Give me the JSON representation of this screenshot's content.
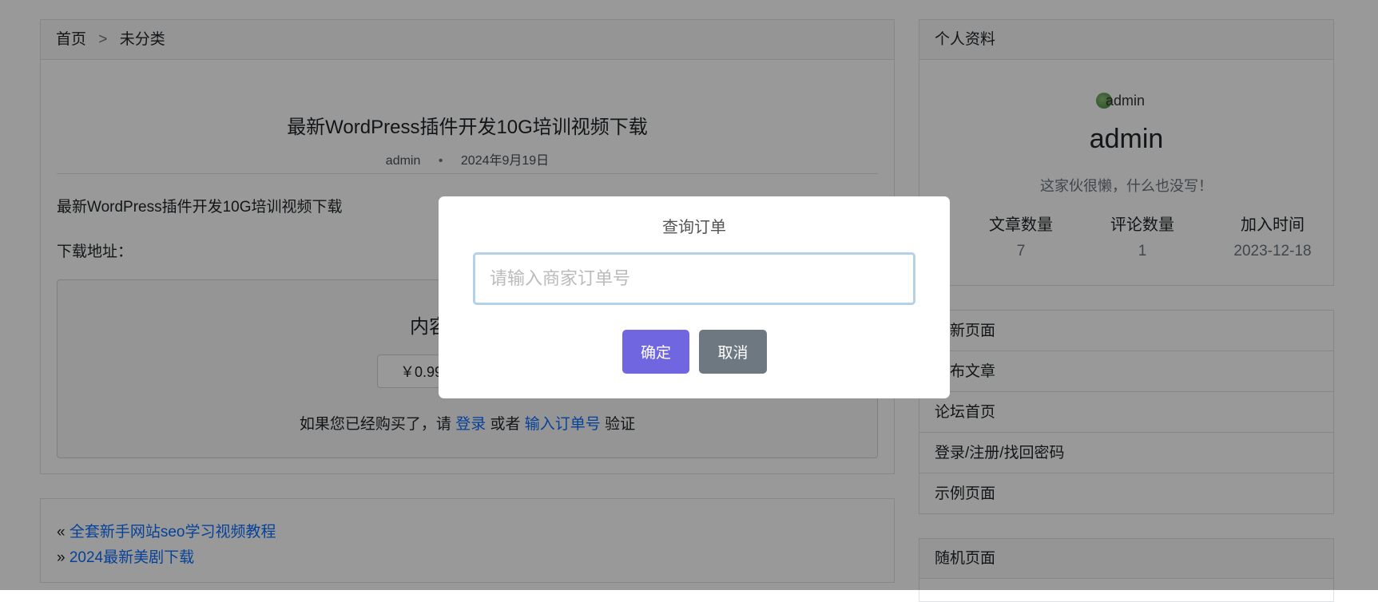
{
  "breadcrumb": {
    "home": "首页",
    "separator": ">",
    "category": "未分类"
  },
  "post": {
    "title": "最新WordPress插件开发10G培训视频下载",
    "author": "admin",
    "meta_dot": "•",
    "date": "2024年9月19日",
    "body_text": "最新WordPress插件开发10G培训视频下载",
    "download_label": "下载地址：",
    "hidden_title": "内容已被隐藏",
    "price": "￥0.99",
    "verify": {
      "prefix": "如果您已经购买了，请",
      "login": "登录",
      "or": "或者",
      "order": "输入订单号",
      "suffix": "验证"
    }
  },
  "post_nav": {
    "prev_symbol": "«",
    "prev_title": "全套新手网站seo学习视频教程",
    "next_symbol": "»",
    "next_title": "2024最新美剧下载"
  },
  "profile": {
    "header": "个人资料",
    "avatar_alt": "admin",
    "name": "admin",
    "bio": "这家伙很懒，什么也没写！",
    "stats": [
      {
        "label": "文章数量",
        "value": "7"
      },
      {
        "label": "评论数量",
        "value": "1"
      },
      {
        "label": "加入时间",
        "value": "2023-12-18"
      }
    ]
  },
  "pages": [
    "最新页面",
    "发布文章",
    "论坛首页",
    "登录/注册/找回密码",
    "示例页面"
  ],
  "random": {
    "header": "随机页面"
  },
  "modal": {
    "title": "查询订单",
    "input_placeholder": "请输入商家订单号",
    "confirm": "确定",
    "cancel": "取消"
  },
  "colors": {
    "confirm": "#7066e0",
    "cancel": "#6e7881",
    "link": "#0d6efd"
  }
}
